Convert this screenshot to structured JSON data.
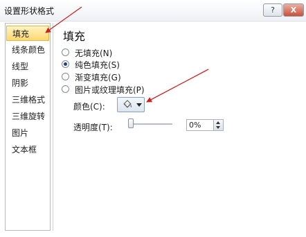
{
  "window": {
    "title": "设置形状格式",
    "help_label": "?",
    "close_label": "X"
  },
  "sidebar": {
    "items": [
      {
        "label": "填充",
        "active": true
      },
      {
        "label": "线条颜色"
      },
      {
        "label": "线型"
      },
      {
        "label": "阴影"
      },
      {
        "label": "三维格式"
      },
      {
        "label": "三维旋转"
      },
      {
        "label": "图片"
      },
      {
        "label": "文本框"
      }
    ]
  },
  "fill": {
    "heading": "填充",
    "options": [
      {
        "label": "无填充(N)"
      },
      {
        "label": "纯色填充(S)",
        "checked": true
      },
      {
        "label": "渐变填充(G)"
      },
      {
        "label": "图片或纹理填充(P)"
      }
    ],
    "color_label": "颜色(C):",
    "color_icon": "paint-bucket-icon",
    "transparency_label": "透明度(T):",
    "transparency_value": "0%",
    "transparency_fraction": 0
  },
  "colors": {
    "annotation_arrow": "#c8241e",
    "active_item": "#ffd770"
  }
}
